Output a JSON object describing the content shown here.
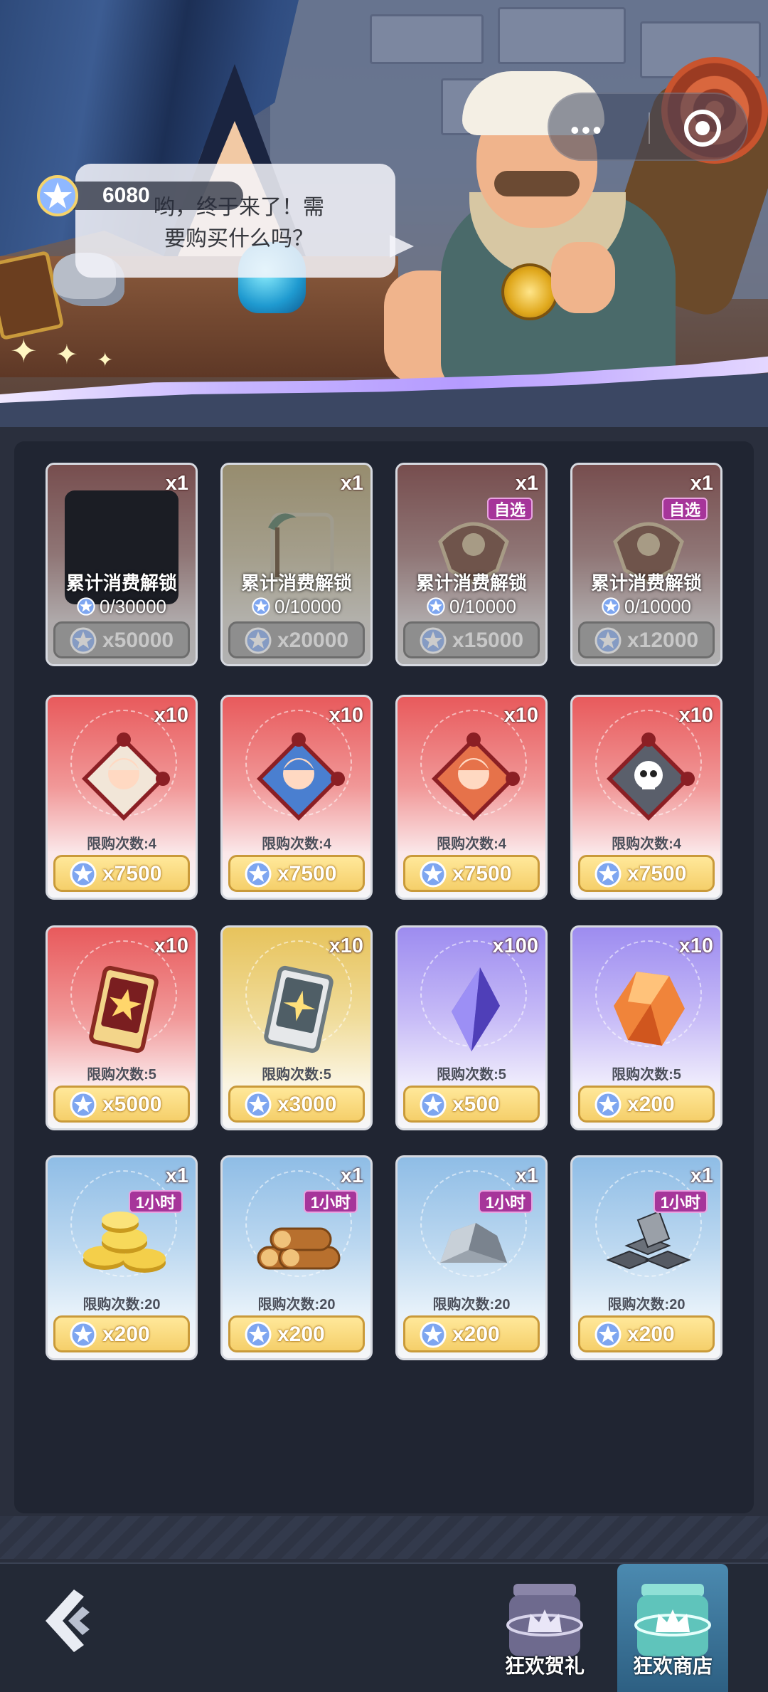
{
  "currency": {
    "value": "6080",
    "icon": "star-coin-icon"
  },
  "dialog": {
    "line1": "哟，终于来了！需",
    "line2": "要购买什么吗？"
  },
  "capsule": {
    "menu_icon": "more-dots-icon",
    "close_icon": "target-close-icon"
  },
  "locked_items": [
    {
      "qty": "x1",
      "tag": "",
      "unlock_label": "累计消费解锁",
      "progress": "0/30000",
      "price": "x50000",
      "art": "beach-umbrella-frame",
      "theme": "red"
    },
    {
      "qty": "x1",
      "tag": "",
      "unlock_label": "累计消费解锁",
      "progress": "0/10000",
      "price": "x20000",
      "art": "palm-frame",
      "theme": "gold"
    },
    {
      "qty": "x1",
      "tag": "自选",
      "unlock_label": "累计消费解锁",
      "progress": "0/10000",
      "price": "x15000",
      "art": "crest-frame",
      "theme": "red"
    },
    {
      "qty": "x1",
      "tag": "自选",
      "unlock_label": "累计消费解锁",
      "progress": "0/10000",
      "price": "x12000",
      "art": "crest-frame",
      "theme": "red"
    }
  ],
  "items": [
    {
      "qty": "x10",
      "tag": "",
      "limit": "限购次数:4",
      "price": "x7500",
      "art": "puzzle-hero-a",
      "theme": "red"
    },
    {
      "qty": "x10",
      "tag": "",
      "limit": "限购次数:4",
      "price": "x7500",
      "art": "puzzle-hero-b",
      "theme": "red"
    },
    {
      "qty": "x10",
      "tag": "",
      "limit": "限购次数:4",
      "price": "x7500",
      "art": "puzzle-hero-c",
      "theme": "red"
    },
    {
      "qty": "x10",
      "tag": "",
      "limit": "限购次数:4",
      "price": "x7500",
      "art": "puzzle-skull",
      "theme": "red"
    },
    {
      "qty": "x10",
      "tag": "",
      "limit": "限购次数:5",
      "price": "x5000",
      "art": "ticket-red",
      "theme": "red"
    },
    {
      "qty": "x10",
      "tag": "",
      "limit": "限购次数:5",
      "price": "x3000",
      "art": "ticket-gray",
      "theme": "gold"
    },
    {
      "qty": "x100",
      "tag": "",
      "limit": "限购次数:5",
      "price": "x500",
      "art": "crystal-purple",
      "theme": "purple"
    },
    {
      "qty": "x10",
      "tag": "",
      "limit": "限购次数:5",
      "price": "x200",
      "art": "crystal-orange",
      "theme": "purple"
    },
    {
      "qty": "x1",
      "tag": "1小时",
      "limit": "限购次数:20",
      "price": "x200",
      "art": "gold-coins",
      "theme": "blue"
    },
    {
      "qty": "x1",
      "tag": "1小时",
      "limit": "限购次数:20",
      "price": "x200",
      "art": "wood-logs",
      "theme": "blue"
    },
    {
      "qty": "x1",
      "tag": "1小时",
      "limit": "限购次数:20",
      "price": "x200",
      "art": "stone-ore",
      "theme": "blue"
    },
    {
      "qty": "x1",
      "tag": "1小时",
      "limit": "限购次数:20",
      "price": "x200",
      "art": "iron-ingots",
      "theme": "blue"
    }
  ],
  "bottom": {
    "back_icon": "back-arrow-icon",
    "tab1": "狂欢贺礼",
    "tab2": "狂欢商店",
    "active": "狂欢商店"
  }
}
